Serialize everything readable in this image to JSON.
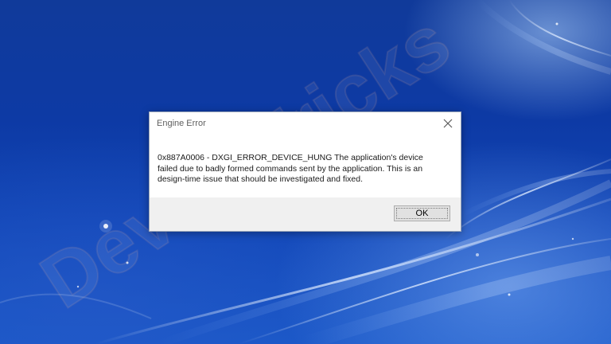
{
  "dialog": {
    "title": "Engine Error",
    "message": "0x887A0006 - DXGI_ERROR_DEVICE_HUNG The application's device\nfailed due to badly formed commands sent by the application. This is an\ndesign-time issue that should be investigated and fixed.",
    "ok_label": "OK",
    "close_icon": "close-icon"
  },
  "watermark": {
    "text": "DeviceTricks"
  },
  "colors": {
    "desktop_blue": "#0d3aa5",
    "dialog_bg": "#ffffff",
    "footer_bg": "#f0f0f0",
    "button_bg": "#e1e1e1"
  }
}
